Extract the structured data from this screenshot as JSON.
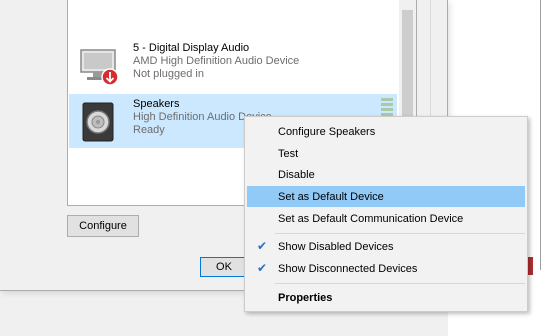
{
  "devices": [
    {
      "name": "5 - Digital Display Audio",
      "description": "AMD High Definition Audio Device",
      "status": "Not plugged in",
      "icon": "monitor-icon"
    },
    {
      "name": "Speakers",
      "description": "High Definition Audio Device",
      "status": "Ready",
      "icon": "speaker-icon",
      "selected": true
    }
  ],
  "buttons": {
    "configure": "Configure",
    "ok": "OK"
  },
  "context_menu": {
    "items": [
      {
        "label": "Configure Speakers"
      },
      {
        "label": "Test"
      },
      {
        "label": "Disable"
      },
      {
        "label": "Set as Default Device",
        "highlighted": true
      },
      {
        "label": "Set as Default Communication Device"
      },
      {
        "label": "Show Disabled Devices",
        "checked": true
      },
      {
        "label": "Show Disconnected Devices",
        "checked": true
      },
      {
        "label": "Properties",
        "bold": true
      }
    ]
  },
  "colors": {
    "selection": "#cce8ff",
    "menu_highlight": "#91c9f7",
    "check": "#2a6fbf"
  }
}
